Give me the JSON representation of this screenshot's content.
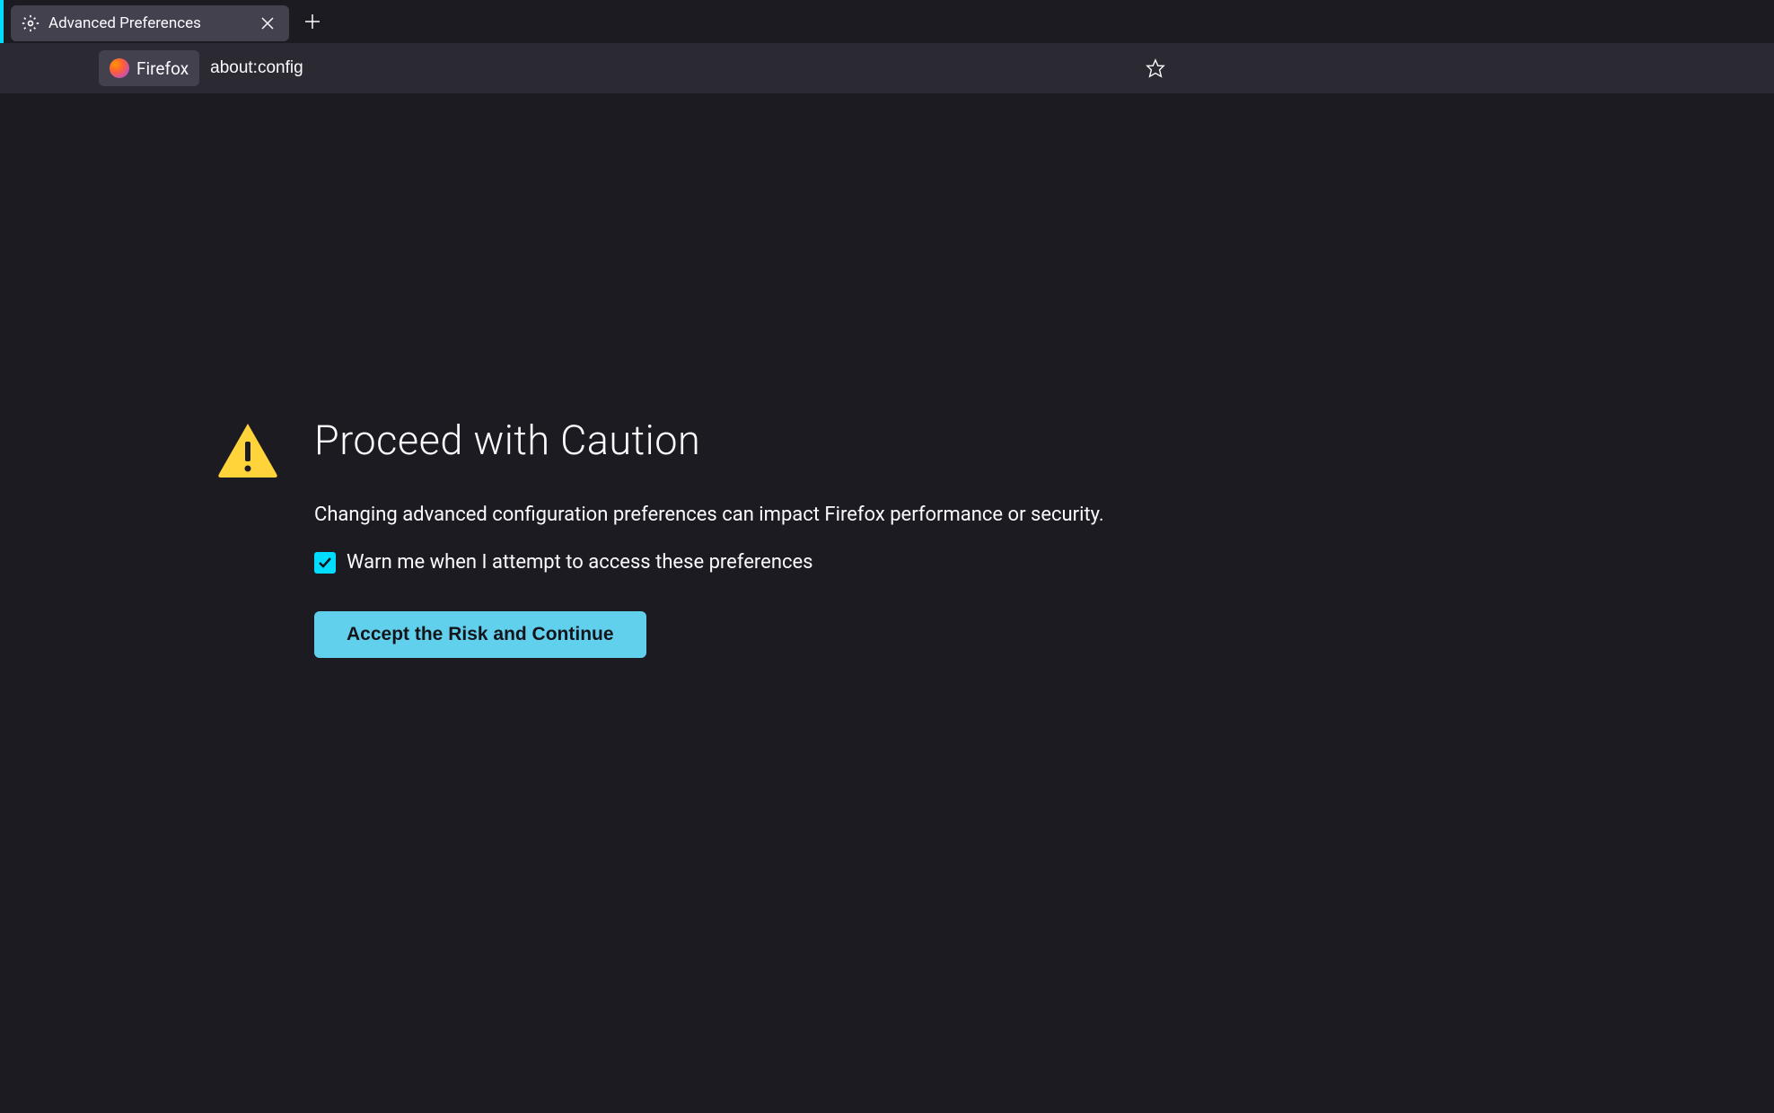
{
  "tab": {
    "title": "Advanced Preferences"
  },
  "addressBar": {
    "identityLabel": "Firefox",
    "url": "about:config"
  },
  "warning": {
    "title": "Proceed with Caution",
    "description": "Changing advanced configuration preferences can impact Firefox performance or security.",
    "checkboxLabel": "Warn me when I attempt to access these preferences",
    "acceptButton": "Accept the Risk and Continue"
  }
}
